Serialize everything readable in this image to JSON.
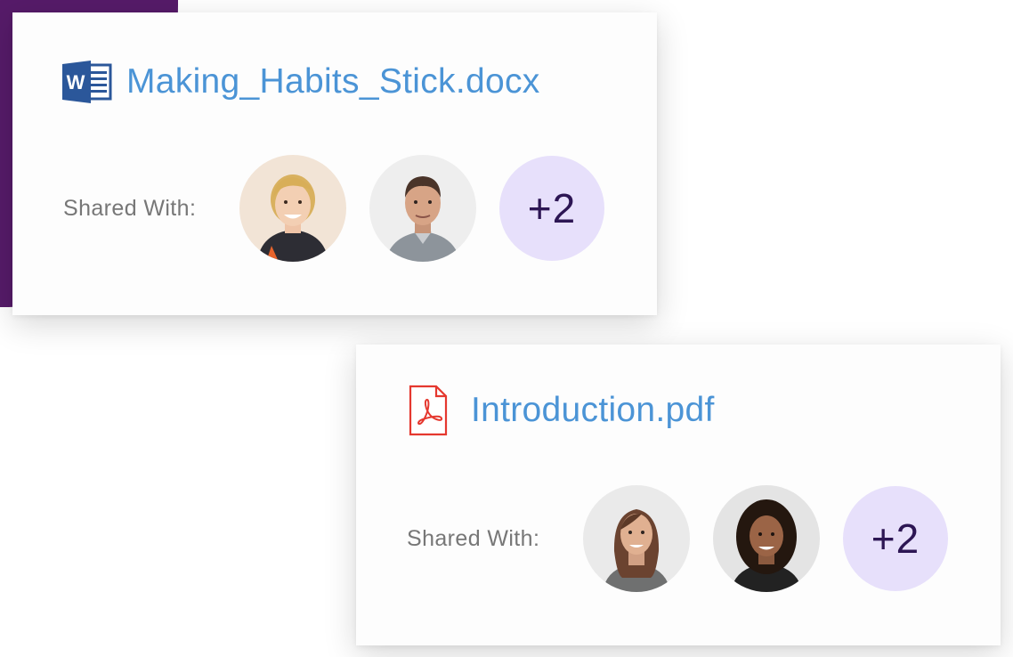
{
  "cards": [
    {
      "file_name": "Making_Habits_Stick.docx",
      "file_type_icon": "word-document-icon",
      "shared_label": "Shared With:",
      "avatars": [
        {
          "name": "avatar-blonde-woman"
        },
        {
          "name": "avatar-man-dark-hair"
        }
      ],
      "more_count": "+2"
    },
    {
      "file_name": "Introduction.pdf",
      "file_type_icon": "pdf-document-icon",
      "shared_label": "Shared With:",
      "avatars": [
        {
          "name": "avatar-brunette-woman"
        },
        {
          "name": "avatar-woman-curly-hair"
        }
      ],
      "more_count": "+2"
    }
  ],
  "colors": {
    "accent_purple": "#561b69",
    "file_name_blue": "#4b94d6",
    "badge_bg": "#e7e0fb",
    "badge_text": "#2d1654",
    "word_blue": "#2b579a",
    "pdf_red": "#e5382f"
  }
}
